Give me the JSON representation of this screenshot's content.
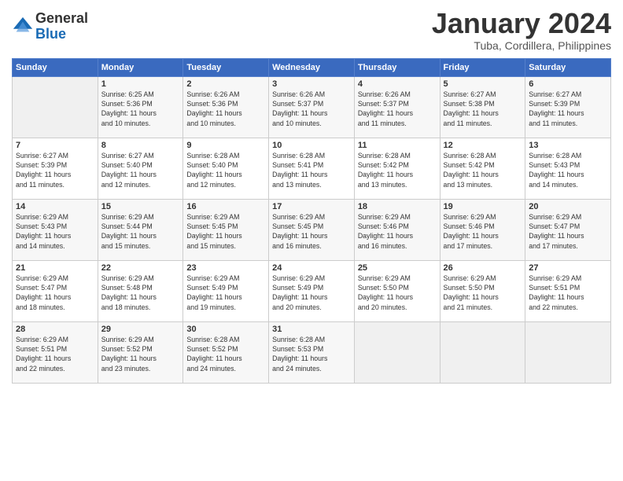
{
  "header": {
    "logo_line1": "General",
    "logo_line2": "Blue",
    "title": "January 2024",
    "subtitle": "Tuba, Cordillera, Philippines"
  },
  "weekdays": [
    "Sunday",
    "Monday",
    "Tuesday",
    "Wednesday",
    "Thursday",
    "Friday",
    "Saturday"
  ],
  "weeks": [
    [
      {
        "day": "",
        "info": ""
      },
      {
        "day": "1",
        "info": "Sunrise: 6:25 AM\nSunset: 5:36 PM\nDaylight: 11 hours\nand 10 minutes."
      },
      {
        "day": "2",
        "info": "Sunrise: 6:26 AM\nSunset: 5:36 PM\nDaylight: 11 hours\nand 10 minutes."
      },
      {
        "day": "3",
        "info": "Sunrise: 6:26 AM\nSunset: 5:37 PM\nDaylight: 11 hours\nand 10 minutes."
      },
      {
        "day": "4",
        "info": "Sunrise: 6:26 AM\nSunset: 5:37 PM\nDaylight: 11 hours\nand 11 minutes."
      },
      {
        "day": "5",
        "info": "Sunrise: 6:27 AM\nSunset: 5:38 PM\nDaylight: 11 hours\nand 11 minutes."
      },
      {
        "day": "6",
        "info": "Sunrise: 6:27 AM\nSunset: 5:39 PM\nDaylight: 11 hours\nand 11 minutes."
      }
    ],
    [
      {
        "day": "7",
        "info": "Sunrise: 6:27 AM\nSunset: 5:39 PM\nDaylight: 11 hours\nand 11 minutes."
      },
      {
        "day": "8",
        "info": "Sunrise: 6:27 AM\nSunset: 5:40 PM\nDaylight: 11 hours\nand 12 minutes."
      },
      {
        "day": "9",
        "info": "Sunrise: 6:28 AM\nSunset: 5:40 PM\nDaylight: 11 hours\nand 12 minutes."
      },
      {
        "day": "10",
        "info": "Sunrise: 6:28 AM\nSunset: 5:41 PM\nDaylight: 11 hours\nand 13 minutes."
      },
      {
        "day": "11",
        "info": "Sunrise: 6:28 AM\nSunset: 5:42 PM\nDaylight: 11 hours\nand 13 minutes."
      },
      {
        "day": "12",
        "info": "Sunrise: 6:28 AM\nSunset: 5:42 PM\nDaylight: 11 hours\nand 13 minutes."
      },
      {
        "day": "13",
        "info": "Sunrise: 6:28 AM\nSunset: 5:43 PM\nDaylight: 11 hours\nand 14 minutes."
      }
    ],
    [
      {
        "day": "14",
        "info": "Sunrise: 6:29 AM\nSunset: 5:43 PM\nDaylight: 11 hours\nand 14 minutes."
      },
      {
        "day": "15",
        "info": "Sunrise: 6:29 AM\nSunset: 5:44 PM\nDaylight: 11 hours\nand 15 minutes."
      },
      {
        "day": "16",
        "info": "Sunrise: 6:29 AM\nSunset: 5:45 PM\nDaylight: 11 hours\nand 15 minutes."
      },
      {
        "day": "17",
        "info": "Sunrise: 6:29 AM\nSunset: 5:45 PM\nDaylight: 11 hours\nand 16 minutes."
      },
      {
        "day": "18",
        "info": "Sunrise: 6:29 AM\nSunset: 5:46 PM\nDaylight: 11 hours\nand 16 minutes."
      },
      {
        "day": "19",
        "info": "Sunrise: 6:29 AM\nSunset: 5:46 PM\nDaylight: 11 hours\nand 17 minutes."
      },
      {
        "day": "20",
        "info": "Sunrise: 6:29 AM\nSunset: 5:47 PM\nDaylight: 11 hours\nand 17 minutes."
      }
    ],
    [
      {
        "day": "21",
        "info": "Sunrise: 6:29 AM\nSunset: 5:47 PM\nDaylight: 11 hours\nand 18 minutes."
      },
      {
        "day": "22",
        "info": "Sunrise: 6:29 AM\nSunset: 5:48 PM\nDaylight: 11 hours\nand 18 minutes."
      },
      {
        "day": "23",
        "info": "Sunrise: 6:29 AM\nSunset: 5:49 PM\nDaylight: 11 hours\nand 19 minutes."
      },
      {
        "day": "24",
        "info": "Sunrise: 6:29 AM\nSunset: 5:49 PM\nDaylight: 11 hours\nand 20 minutes."
      },
      {
        "day": "25",
        "info": "Sunrise: 6:29 AM\nSunset: 5:50 PM\nDaylight: 11 hours\nand 20 minutes."
      },
      {
        "day": "26",
        "info": "Sunrise: 6:29 AM\nSunset: 5:50 PM\nDaylight: 11 hours\nand 21 minutes."
      },
      {
        "day": "27",
        "info": "Sunrise: 6:29 AM\nSunset: 5:51 PM\nDaylight: 11 hours\nand 22 minutes."
      }
    ],
    [
      {
        "day": "28",
        "info": "Sunrise: 6:29 AM\nSunset: 5:51 PM\nDaylight: 11 hours\nand 22 minutes."
      },
      {
        "day": "29",
        "info": "Sunrise: 6:29 AM\nSunset: 5:52 PM\nDaylight: 11 hours\nand 23 minutes."
      },
      {
        "day": "30",
        "info": "Sunrise: 6:28 AM\nSunset: 5:52 PM\nDaylight: 11 hours\nand 24 minutes."
      },
      {
        "day": "31",
        "info": "Sunrise: 6:28 AM\nSunset: 5:53 PM\nDaylight: 11 hours\nand 24 minutes."
      },
      {
        "day": "",
        "info": ""
      },
      {
        "day": "",
        "info": ""
      },
      {
        "day": "",
        "info": ""
      }
    ]
  ]
}
